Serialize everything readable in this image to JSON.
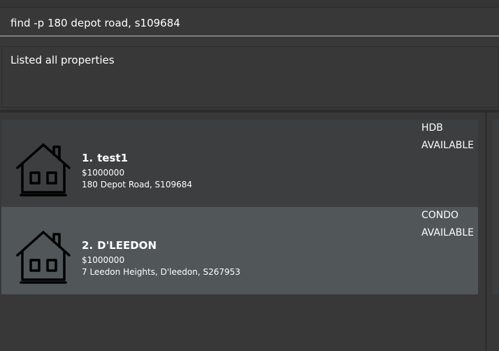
{
  "command_box": {
    "value": "find -p 180 depot road, s109684"
  },
  "result_display": {
    "message": "Listed all properties"
  },
  "property_list": [
    {
      "index": "1.",
      "name": "test1",
      "price": "$1000000",
      "address": "180 Depot Road, S109684",
      "type": "HDB",
      "status": "AVAILABLE",
      "icon": "house-icon"
    },
    {
      "index": "2.",
      "name": "D'LEEDON",
      "price": "$1000000",
      "address": "7 Leedon Heights, D'leedon, S267953",
      "type": "CONDO",
      "status": "AVAILABLE",
      "icon": "house-icon"
    }
  ],
  "colors": {
    "background": "#383838",
    "card_default": "#3c3e3f",
    "card_selected": "#515658",
    "text": "#ffffff",
    "command_underline": "#bcbcbc"
  }
}
